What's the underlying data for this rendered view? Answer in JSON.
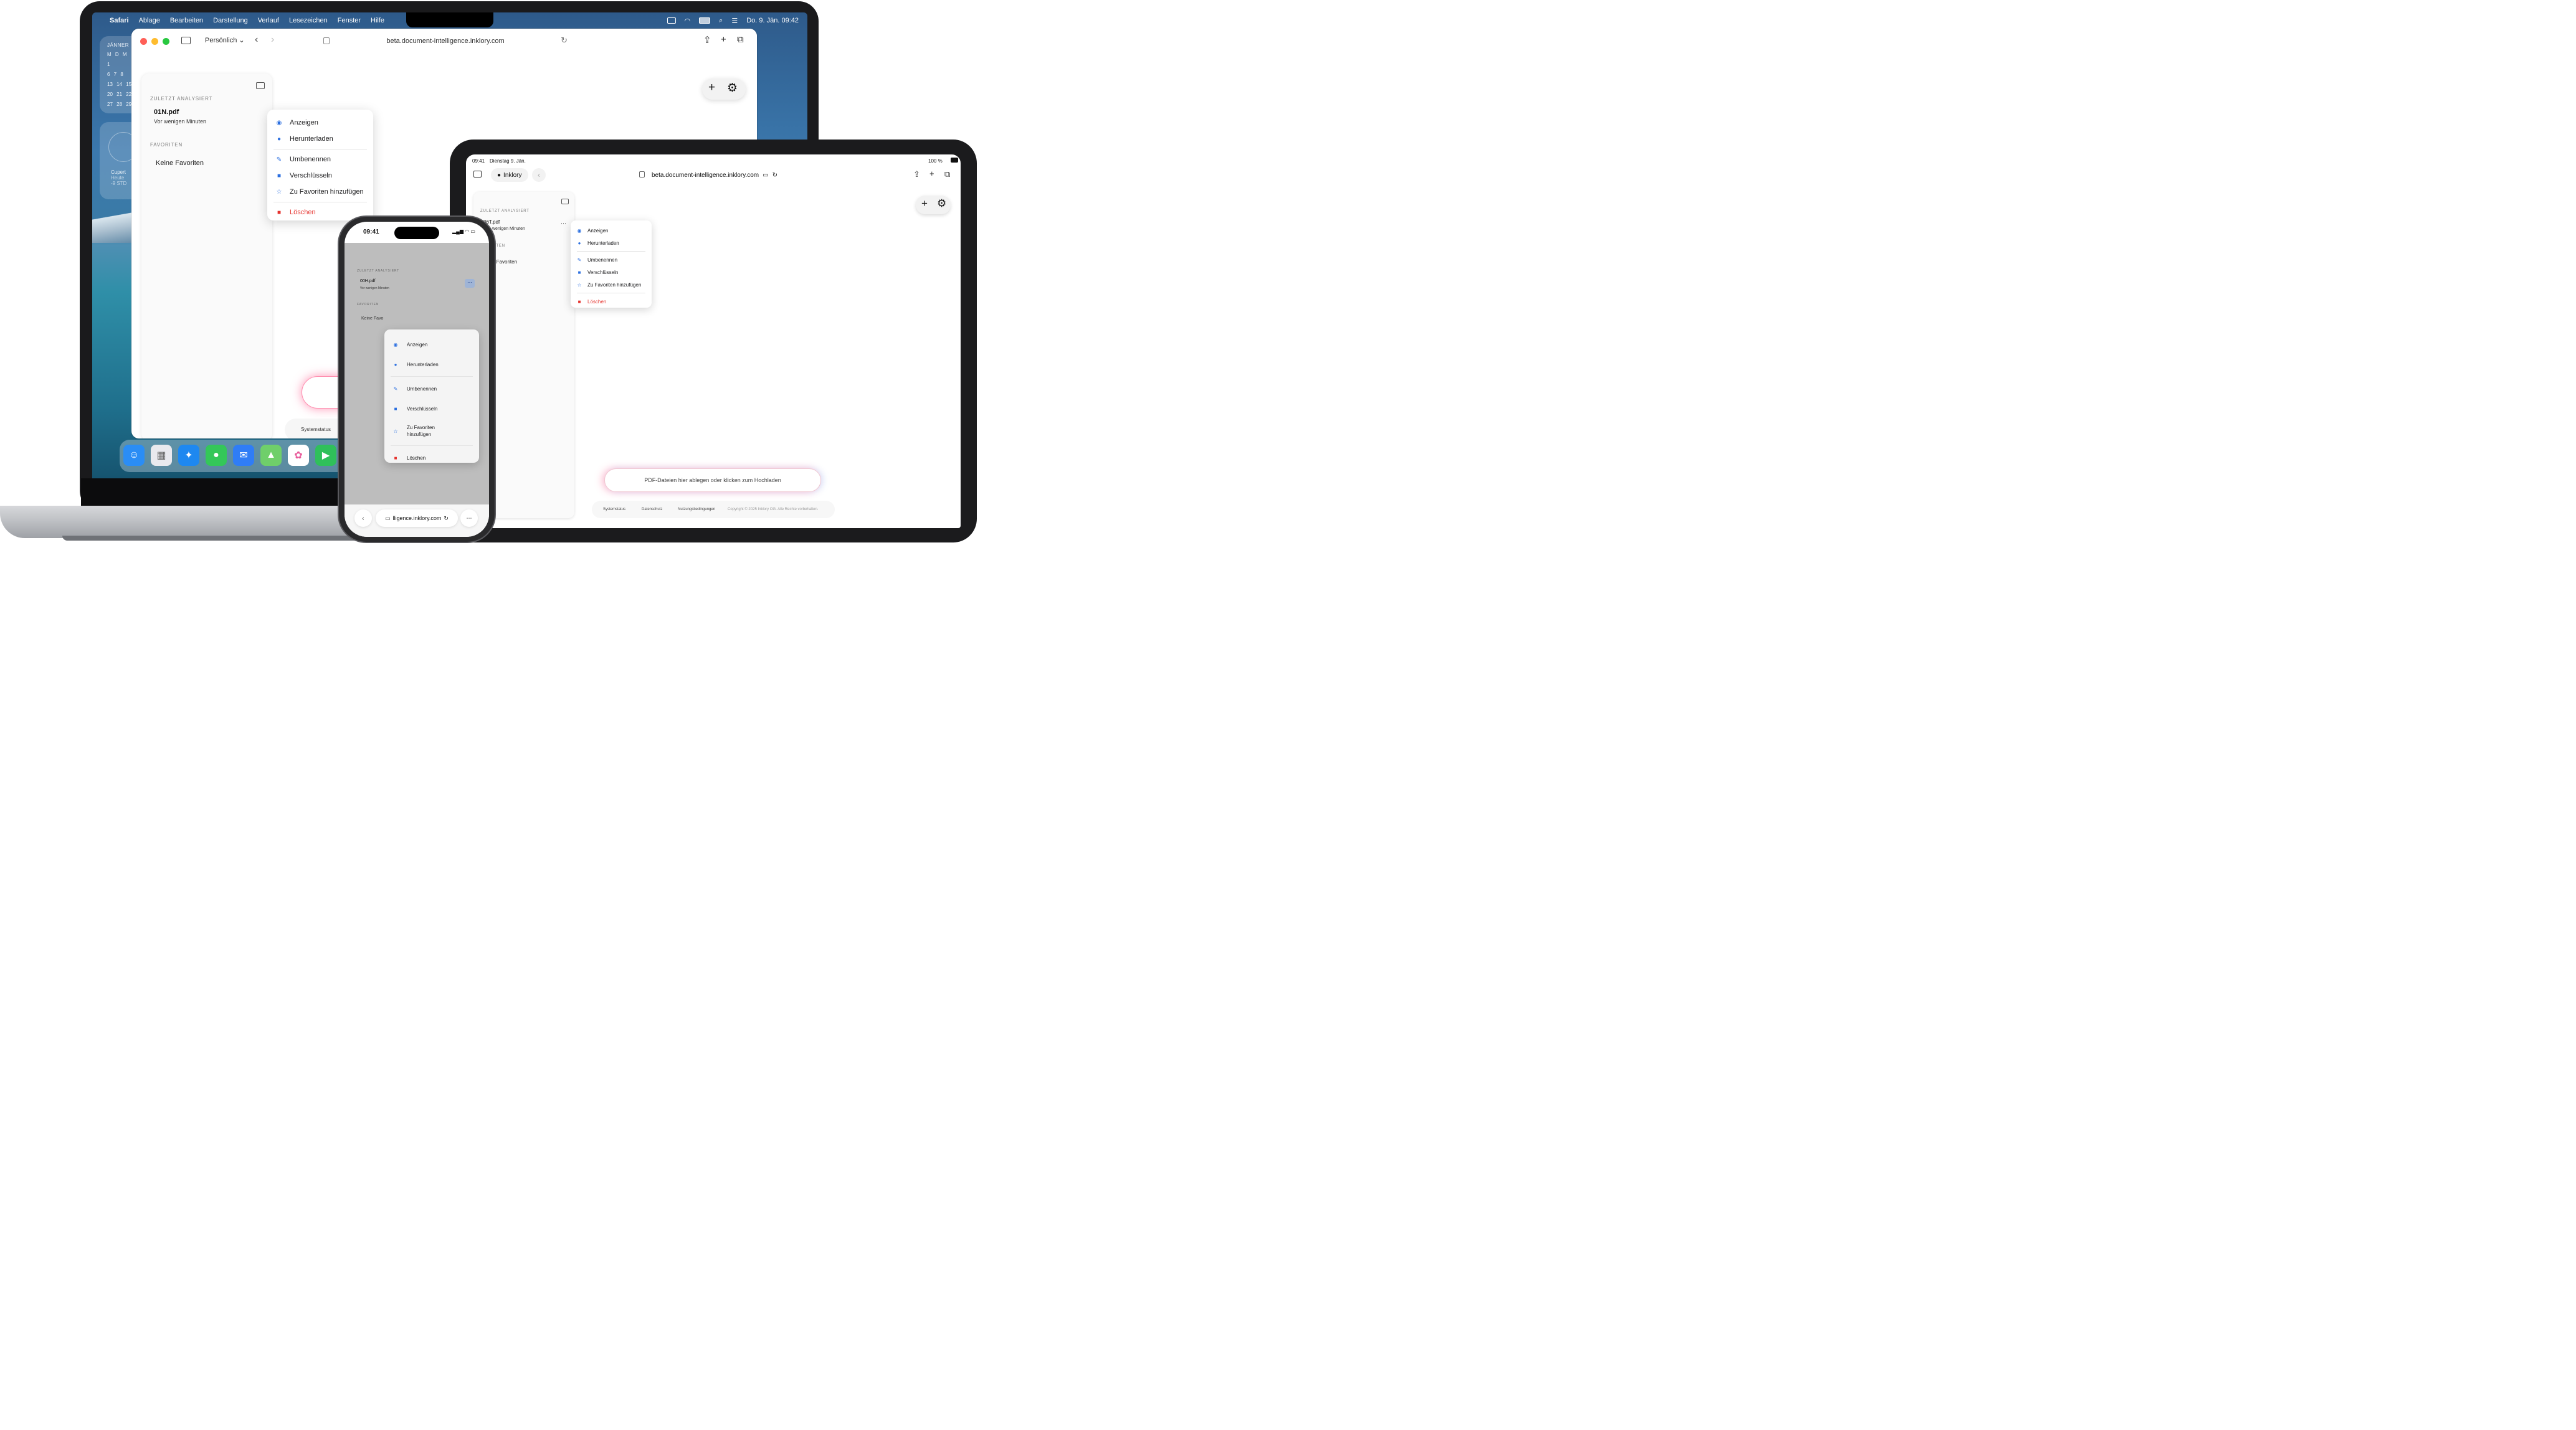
{
  "mac": {
    "menubar": {
      "app": "Safari",
      "items": [
        "Ablage",
        "Bearbeiten",
        "Darstellung",
        "Verlauf",
        "Lesezeichen",
        "Fenster",
        "Hilfe"
      ],
      "datetime": "Do. 9. Jän.  09:42"
    },
    "calendar_widget": {
      "month": "JÄNNER",
      "rows": [
        "M  D  M",
        "            1",
        "6   7   8",
        "13  14  15",
        "20  21  22",
        "27  28  29"
      ]
    },
    "clock_widget": {
      "city": "Cupert",
      "sub": "Heute",
      "offset": "-9 STD"
    },
    "safari": {
      "profile": "Persönlich",
      "url": "beta.document-intelligence.inklory.com"
    },
    "sidebar": {
      "recent_label": "ZULETZT ANALYSIERT",
      "file_name": "01N.pdf",
      "file_time": "Vor wenigen Minuten",
      "favorites_label": "FAVORITEN",
      "no_favorites": "Keine Favoriten"
    },
    "context_menu": {
      "view": "Anzeigen",
      "download": "Herunterladen",
      "rename": "Umbenennen",
      "encrypt": "Verschlüsseln",
      "favorite": "Zu Favoriten hinzufügen",
      "delete": "Löschen"
    },
    "footer": {
      "system_status": "Systemstatus"
    }
  },
  "ipad": {
    "status": {
      "time": "09:41",
      "date": "Dienstag 9. Jän.",
      "battery": "100 %"
    },
    "toolbar": {
      "profile": "Inklory",
      "url": "beta.document-intelligence.inklory.com"
    },
    "sidebar": {
      "recent_label": "ZULETZT ANALYSIERT",
      "file_name": "06T.pdf",
      "file_time": "wenigen Minuten",
      "favorites_label": "ITEN",
      "no_favorites": "e Favoriten"
    },
    "context_menu": {
      "view": "Anzeigen",
      "download": "Herunterladen",
      "rename": "Umbenennen",
      "encrypt": "Verschlüsseln",
      "favorite": "Zu Favoriten hinzufügen",
      "delete": "Löschen"
    },
    "upload_text": "PDF-Dateien hier ablegen oder klicken zum Hochladen",
    "footer": {
      "system_status": "Systemstatus",
      "privacy": "Datenschutz",
      "terms": "Nutzungsbedingungen",
      "copyright": "Copyright © 2025 Inklory OG. Alle Rechte vorbehalten."
    }
  },
  "iphone": {
    "time": "09:41",
    "sidebar": {
      "recent_label": "ZULETZT ANALYSIERT",
      "file_name": "00H.pdf",
      "file_time": "Vor wenigen Minuten",
      "favorites_label": "FAVORITEN",
      "no_favorites": "Keine Favo"
    },
    "context_menu": {
      "view": "Anzeigen",
      "download": "Herunterladen",
      "rename": "Umbenennen",
      "encrypt": "Verschlüsseln",
      "favorite_line1": "Zu Favoriten",
      "favorite_line2": "hinzufügen",
      "delete": "Löschen"
    },
    "url": "lligence.inklory.com"
  },
  "colors": {
    "accent": "#2b6fe0",
    "danger": "#e5322d"
  }
}
